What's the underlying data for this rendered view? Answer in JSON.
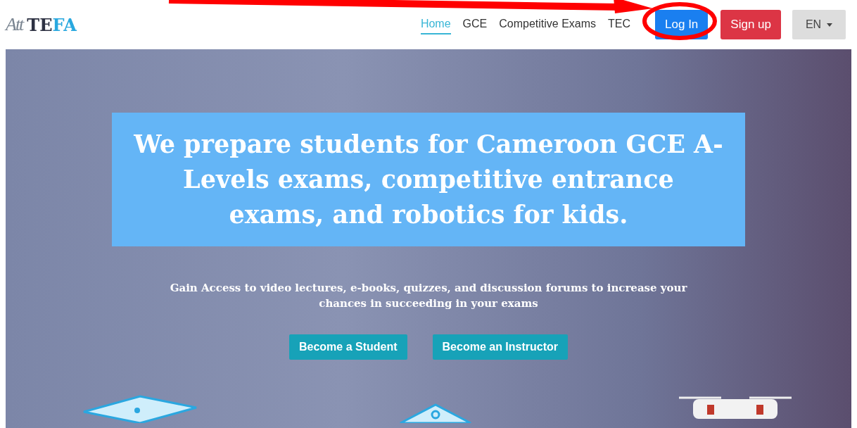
{
  "header": {
    "logo": {
      "mark": "Att",
      "name_dark": "TE",
      "name_accent": "FA"
    },
    "nav": [
      {
        "label": "Home",
        "selected": true
      },
      {
        "label": "GCE",
        "selected": false
      },
      {
        "label": "Competitive Exams",
        "selected": false
      },
      {
        "label": "TEC",
        "selected": false
      }
    ],
    "buttons": [
      {
        "label": "Log In",
        "kind": "primary"
      },
      {
        "label": "Sign up",
        "kind": "danger"
      }
    ],
    "language": {
      "label": "EN"
    }
  },
  "hero": {
    "title": "We prepare students for Cameroon GCE A-Levels exams, competitive entrance exams, and robotics for kids.",
    "subtitle": "Gain Access to video lectures, e-books, quizzes, and discussion forums to increase your chances in succeeding in your exams",
    "actions": [
      "Become a Student",
      "Become an Instructor"
    ]
  }
}
